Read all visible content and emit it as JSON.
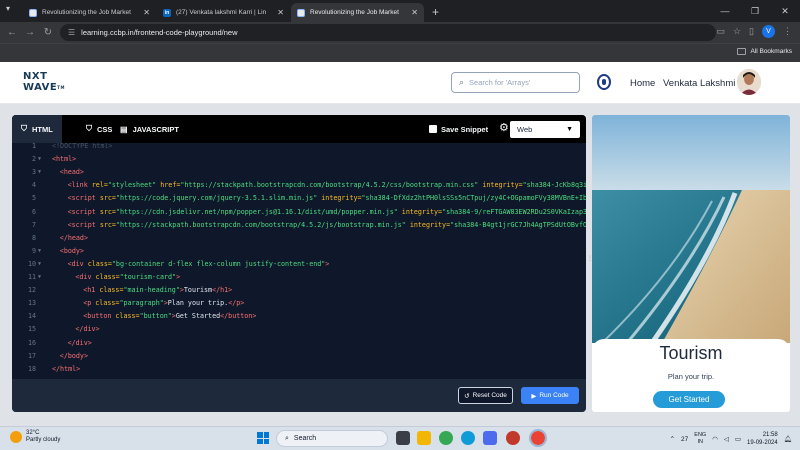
{
  "browser": {
    "tabs": [
      {
        "title": "Revolutionizing the Job Market",
        "favicon": "doc-icon",
        "active": false
      },
      {
        "title": "(27) Venkata lakshmi Karri | Lin",
        "favicon": "linkedin-icon",
        "active": false
      },
      {
        "title": "Revolutionizing the Job Market",
        "favicon": "doc-icon",
        "active": true
      }
    ],
    "new_tab": "+",
    "url": "learning.ccbp.in/frontend-code-playground/new",
    "profile_initial": "V",
    "all_bookmarks": "All Bookmarks"
  },
  "header": {
    "logo_line1": "NXT",
    "logo_line2": "WAVE",
    "logo_tm": "TM",
    "search_placeholder": "Search for 'Arrays'",
    "home": "Home",
    "user_name": "Venkata Lakshmi"
  },
  "editor": {
    "tabs": [
      {
        "label": "HTML",
        "icon": "html5-icon",
        "active": true
      },
      {
        "label": "CSS",
        "icon": "css3-icon",
        "active": false
      },
      {
        "label": "JAVASCRIPT",
        "icon": "js-icon",
        "active": false
      }
    ],
    "save_snippet": "Save Snippet",
    "mode": "Web",
    "code_lines": [
      {
        "n": "1",
        "fold": "",
        "indent": 0,
        "html": "<span class='cm'>&lt;!DOCTYPE html&gt;</span>"
      },
      {
        "n": "2",
        "fold": "▼",
        "indent": 0,
        "html": "<span class='tg'>&lt;html&gt;</span>"
      },
      {
        "n": "3",
        "fold": "▼",
        "indent": 1,
        "html": "<span class='tg'>&lt;head&gt;</span>"
      },
      {
        "n": "4",
        "fold": "",
        "indent": 2,
        "html": "<span class='tg'>&lt;link</span> <span class='at'>rel=</span><span class='vl'>\"stylesheet\"</span> <span class='at'>href=</span><span class='vl'>\"https://stackpath.bootstrapcdn.com/bootstrap/4.5.2/css/bootstrap.min.css\"</span> <span class='at'>integrity=</span><span class='vl'>\"sha384-JcKb8q3iq</span>"
      },
      {
        "n": "5",
        "fold": "",
        "indent": 2,
        "html": "<span class='tg'>&lt;script</span> <span class='at'>src=</span><span class='vl'>\"https://code.jquery.com/jquery-3.5.1.slim.min.js\"</span> <span class='at'>integrity=</span><span class='vl'>\"sha384-DfXdz2htPH0lsSSs5nCTpuj/zy4C+OGpamoFVy38MVBnE+IbbV</span>"
      },
      {
        "n": "6",
        "fold": "",
        "indent": 2,
        "html": "<span class='tg'>&lt;script</span> <span class='at'>src=</span><span class='vl'>\"https://cdn.jsdelivr.net/npm/popper.js@1.16.1/dist/umd/popper.min.js\"</span> <span class='at'>integrity=</span><span class='vl'>\"sha384-9/reFTGAW83EW2RDu2S0VKaIzap3H</span>"
      },
      {
        "n": "7",
        "fold": "",
        "indent": 2,
        "html": "<span class='tg'>&lt;script</span> <span class='at'>src=</span><span class='vl'>\"https://stackpath.bootstrapcdn.com/bootstrap/4.5.2/js/bootstrap.min.js\"</span> <span class='at'>integrity=</span><span class='vl'>\"sha384-B4gt1jrGC7Jh4AgTPSdUtOBvfO8</span>"
      },
      {
        "n": "8",
        "fold": "",
        "indent": 1,
        "html": "<span class='tg'>&lt;/head&gt;</span>"
      },
      {
        "n": "9",
        "fold": "▼",
        "indent": 1,
        "html": "<span class='tg'>&lt;body&gt;</span>"
      },
      {
        "n": "10",
        "fold": "▼",
        "indent": 2,
        "html": "<span class='tg'>&lt;div</span> <span class='at'>class=</span><span class='vl'>\"bg-container d-flex flex-column justify-content-end\"</span><span class='tg'>&gt;</span>"
      },
      {
        "n": "11",
        "fold": "▼",
        "indent": 3,
        "html": "<span class='tg'>&lt;div</span> <span class='at'>class=</span><span class='vl'>\"tourism-card\"</span><span class='tg'>&gt;</span>"
      },
      {
        "n": "12",
        "fold": "",
        "indent": 4,
        "html": "<span class='tg'>&lt;h1</span> <span class='at'>class=</span><span class='vl'>\"main-heading\"</span><span class='tg'>&gt;</span><span class='tx'>Tourism</span><span class='tg'>&lt;/h1&gt;</span>"
      },
      {
        "n": "13",
        "fold": "",
        "indent": 4,
        "html": "<span class='tg'>&lt;p</span> <span class='at'>class=</span><span class='vl'>\"paragraph\"</span><span class='tg'>&gt;</span><span class='tx'>Plan your trip.</span><span class='tg'>&lt;/p&gt;</span>"
      },
      {
        "n": "14",
        "fold": "",
        "indent": 4,
        "html": "<span class='tg'>&lt;button</span> <span class='at'>class=</span><span class='vl'>\"button\"</span><span class='tg'>&gt;</span><span class='tx'>Get Started</span><span class='tg'>&lt;/button&gt;</span>"
      },
      {
        "n": "15",
        "fold": "",
        "indent": 3,
        "html": "<span class='tg'>&lt;/div&gt;</span>"
      },
      {
        "n": "16",
        "fold": "",
        "indent": 2,
        "html": "<span class='tg'>&lt;/div&gt;</span>"
      },
      {
        "n": "17",
        "fold": "",
        "indent": 1,
        "html": "<span class='tg'>&lt;/body&gt;</span>"
      },
      {
        "n": "18",
        "fold": "",
        "indent": 0,
        "html": "<span class='tg'>&lt;/html&gt;</span>"
      }
    ],
    "reset_code": "Reset Code",
    "run_code": "Run Code"
  },
  "preview": {
    "heading": "Tourism",
    "paragraph": "Plan your trip.",
    "button": "Get Started"
  },
  "taskbar": {
    "temperature": "32°C",
    "weather": "Partly cloudy",
    "search": "Search",
    "tray_number": "27",
    "lang_top": "ENG",
    "lang_bottom": "IN",
    "time": "21:58",
    "date": "19-09-2024"
  },
  "colors": {
    "accent_blue": "#3b82f6",
    "preview_button": "#259bd8",
    "editor_bg": "#0f172a",
    "logo_navy": "#183b56"
  }
}
